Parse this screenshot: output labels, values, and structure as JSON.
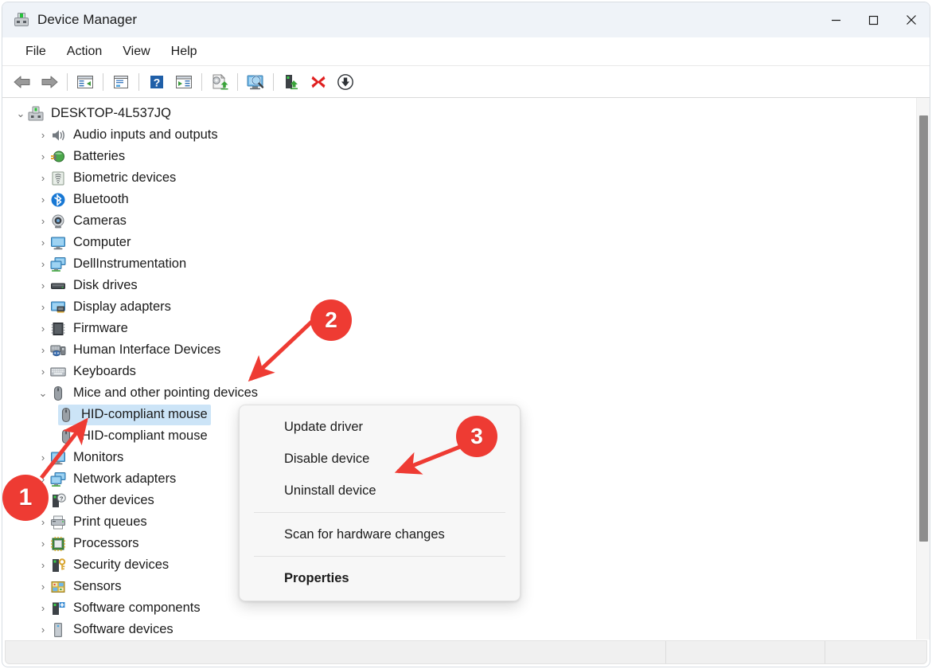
{
  "window": {
    "title": "Device Manager",
    "icon": "device-manager-icon",
    "controls": {
      "minimize": "minimize-button",
      "maximize": "maximize-button",
      "close": "close-button"
    }
  },
  "menubar": {
    "items": [
      {
        "label": "File"
      },
      {
        "label": "Action"
      },
      {
        "label": "View"
      },
      {
        "label": "Help"
      }
    ]
  },
  "toolbar": {
    "buttons": [
      {
        "name": "back-button",
        "icon": "back-arrow-icon"
      },
      {
        "name": "forward-button",
        "icon": "forward-arrow-icon"
      },
      {
        "name": "show-hide-console-tree-button",
        "icon": "console-tree-icon"
      },
      {
        "name": "properties-button",
        "icon": "properties-window-icon"
      },
      {
        "name": "help-button",
        "icon": "help-question-icon"
      },
      {
        "name": "show-hide-action-pane-button",
        "icon": "action-pane-icon"
      },
      {
        "name": "update-driver-button",
        "icon": "update-driver-icon"
      },
      {
        "name": "scan-for-hardware-changes-button",
        "icon": "scan-monitor-icon"
      },
      {
        "name": "uninstall-device-button",
        "icon": "uninstall-device-icon"
      },
      {
        "name": "disable-device-button",
        "icon": "red-x-icon"
      },
      {
        "name": "enable-device-button",
        "icon": "down-arrow-circle-icon"
      }
    ]
  },
  "tree": {
    "root": {
      "label": "DESKTOP-4L537JQ",
      "icon": "computer-device-icon",
      "expanded": true,
      "chevron": "chevron-down"
    },
    "nodes": [
      {
        "label": "Audio inputs and outputs",
        "icon": "speaker-icon",
        "chevron": "chevron-right",
        "level": 1
      },
      {
        "label": "Batteries",
        "icon": "battery-icon",
        "chevron": "chevron-right",
        "level": 1
      },
      {
        "label": "Biometric devices",
        "icon": "fingerprint-icon",
        "chevron": "chevron-right",
        "level": 1
      },
      {
        "label": "Bluetooth",
        "icon": "bluetooth-icon",
        "chevron": "chevron-right",
        "level": 1
      },
      {
        "label": "Cameras",
        "icon": "camera-icon",
        "chevron": "chevron-right",
        "level": 1
      },
      {
        "label": "Computer",
        "icon": "monitor-icon",
        "chevron": "chevron-right",
        "level": 1
      },
      {
        "label": "DellInstrumentation",
        "icon": "multi-monitor-icon",
        "chevron": "chevron-right",
        "level": 1
      },
      {
        "label": "Disk drives",
        "icon": "disk-drive-icon",
        "chevron": "chevron-right",
        "level": 1
      },
      {
        "label": "Display adapters",
        "icon": "display-adapter-icon",
        "chevron": "chevron-right",
        "level": 1
      },
      {
        "label": "Firmware",
        "icon": "firmware-chip-icon",
        "chevron": "chevron-right",
        "level": 1
      },
      {
        "label": "Human Interface Devices",
        "icon": "hid-gamepad-icon",
        "chevron": "chevron-right",
        "level": 1
      },
      {
        "label": "Keyboards",
        "icon": "keyboard-icon",
        "chevron": "chevron-right",
        "level": 1
      },
      {
        "label": "Mice and other pointing devices",
        "icon": "mouse-icon",
        "chevron": "chevron-down",
        "level": 1,
        "expanded": true
      },
      {
        "label": "HID-compliant mouse",
        "icon": "mouse-icon",
        "chevron": "",
        "level": 2,
        "selected": true
      },
      {
        "label": "HID-compliant mouse",
        "icon": "mouse-icon",
        "chevron": "",
        "level": 2
      },
      {
        "label": "Monitors",
        "icon": "monitor-icon",
        "chevron": "chevron-right",
        "level": 1
      },
      {
        "label": "Network adapters",
        "icon": "network-adapter-icon",
        "chevron": "chevron-right",
        "level": 1
      },
      {
        "label": "Other devices",
        "icon": "unknown-device-icon",
        "chevron": "chevron-right",
        "level": 1
      },
      {
        "label": "Print queues",
        "icon": "printer-icon",
        "chevron": "chevron-right",
        "level": 1
      },
      {
        "label": "Processors",
        "icon": "processor-icon",
        "chevron": "chevron-right",
        "level": 1
      },
      {
        "label": "Security devices",
        "icon": "security-key-icon",
        "chevron": "chevron-right",
        "level": 1
      },
      {
        "label": "Sensors",
        "icon": "sensors-icon",
        "chevron": "chevron-right",
        "level": 1
      },
      {
        "label": "Software components",
        "icon": "software-component-icon",
        "chevron": "chevron-right",
        "level": 1
      },
      {
        "label": "Software devices",
        "icon": "software-device-icon",
        "chevron": "chevron-right",
        "level": 1
      }
    ]
  },
  "context_menu": {
    "items": [
      {
        "label": "Update driver",
        "type": "item"
      },
      {
        "label": "Disable device",
        "type": "item"
      },
      {
        "label": "Uninstall device",
        "type": "item"
      },
      {
        "type": "separator"
      },
      {
        "label": "Scan for hardware changes",
        "type": "item"
      },
      {
        "type": "separator"
      },
      {
        "label": "Properties",
        "type": "item",
        "bold": true
      }
    ]
  },
  "annotations": {
    "accent_color": "#ee3b33",
    "badges": [
      {
        "number": "1",
        "target": "HID-compliant mouse (selected tree item)"
      },
      {
        "number": "2",
        "target": "Mice and other pointing devices"
      },
      {
        "number": "3",
        "target": "Uninstall device"
      }
    ]
  },
  "statusbar": {
    "segments": [
      "",
      "",
      ""
    ]
  }
}
